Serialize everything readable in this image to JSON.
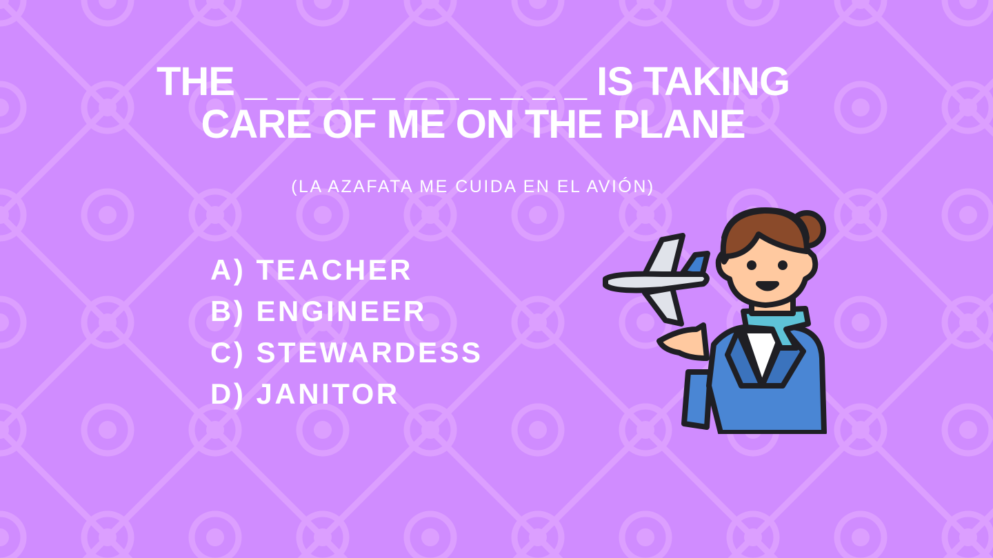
{
  "question": {
    "line1": "THE _ _ _ _ _ _ _ _ _ _ _ IS TAKING",
    "line2": "CARE OF ME ON THE PLANE"
  },
  "translation": "(LA AZAFATA ME CUIDA EN EL AVIÓN)",
  "options": [
    {
      "letter": "A)",
      "text": "TEACHER"
    },
    {
      "letter": "B)",
      "text": "ENGINEER"
    },
    {
      "letter": "C)",
      "text": "STEWARDESS"
    },
    {
      "letter": "D)",
      "text": "JANITOR"
    }
  ],
  "colors": {
    "background": "#d08cff",
    "pattern": "#dc9fff",
    "text": "#ffffff",
    "uniform": "#4a86d4",
    "hair": "#8a4a2a",
    "skin": "#ffc9a0",
    "scarf": "#5ec3d8",
    "airplane": "#e0e3ea"
  },
  "illustration": {
    "icon": "stewardess-with-airplane-icon"
  }
}
